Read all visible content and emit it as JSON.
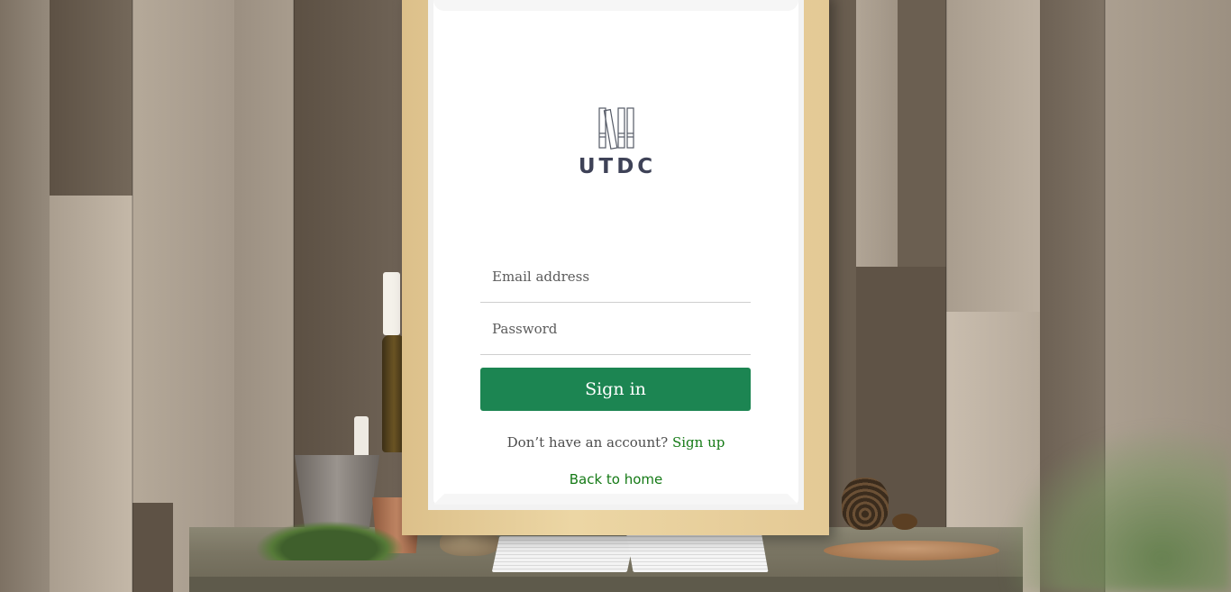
{
  "brand": {
    "logo_text": "UTDC",
    "logo_icon": "books-icon"
  },
  "form": {
    "email_placeholder": "Email address",
    "password_placeholder": "Password",
    "submit_label": "Sign in"
  },
  "footer": {
    "account_prompt": "Don’t have an account?",
    "signup_label": "Sign up",
    "back_home_label": "Back to home"
  },
  "colors": {
    "primary_button": "#1c8552",
    "link": "#157a16",
    "logo": "#3e4257"
  }
}
